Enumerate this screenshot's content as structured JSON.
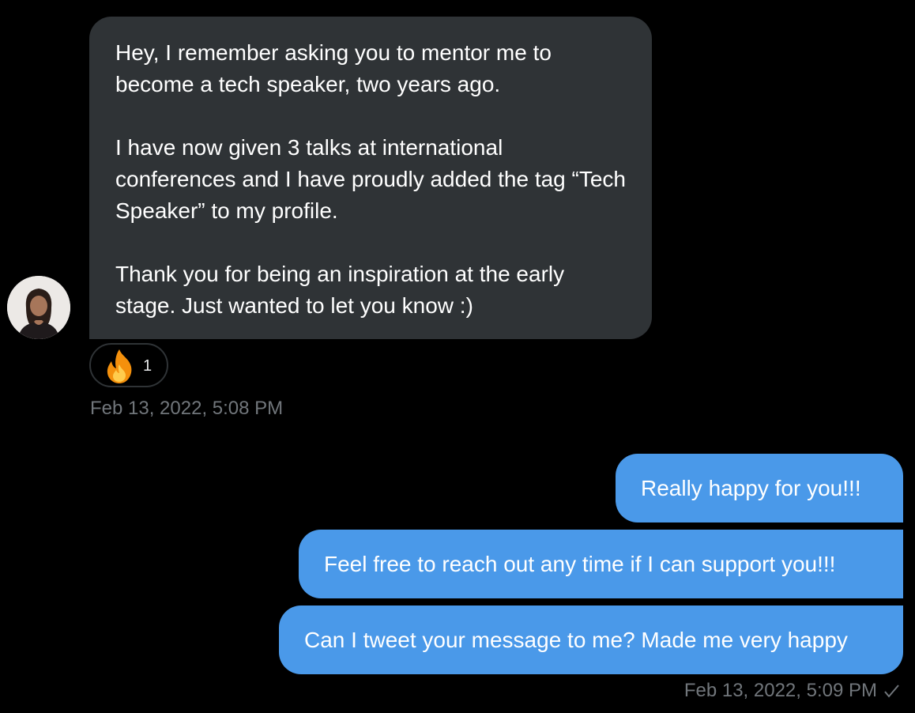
{
  "conversation": {
    "incoming": {
      "paragraphs": [
        "Hey, I remember asking you to mentor me to become a tech speaker, two years ago.",
        "I have now given 3 talks at international conferences and I have proudly added the tag “Tech Speaker” to my profile.",
        "Thank you for being an inspiration at the early stage. Just wanted to let you know :)"
      ],
      "reaction": {
        "emoji": "fire-icon",
        "count": "1"
      },
      "timestamp": "Feb 13, 2022, 5:08 PM"
    },
    "outgoing": {
      "messages": [
        "Really happy for you!!!",
        "Feel free to reach out any time if I can support you!!!",
        "Can I tweet your message to me? Made me very happy"
      ],
      "timestamp": "Feb 13, 2022, 5:09 PM",
      "status_icon": "check-icon"
    }
  },
  "colors": {
    "background": "#000000",
    "incoming_bubble": "#2f3336",
    "outgoing_bubble": "#4a99e9",
    "timestamp_text": "#71767b",
    "message_text": "#ffffff"
  }
}
